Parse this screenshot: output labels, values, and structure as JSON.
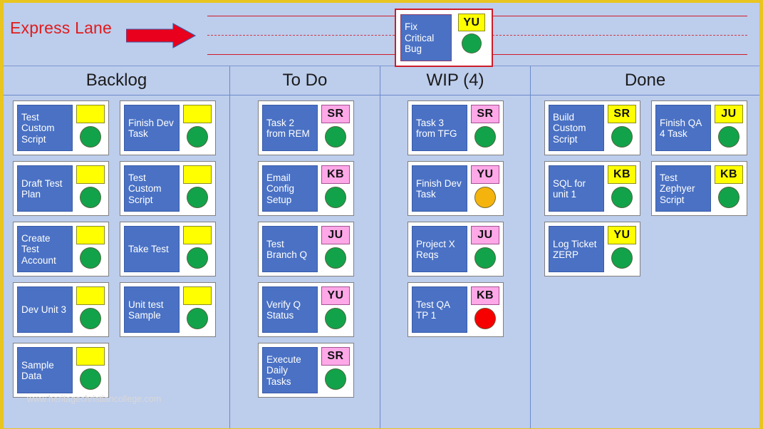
{
  "board": {
    "background_color": "#bdcdec",
    "frame_color": "#e8c520",
    "watermark": "www.heritagechristiancollege.com"
  },
  "express_lane": {
    "label": "Express Lane",
    "label_color": "#e01b1b",
    "arrow_icon": "right-arrow-icon",
    "arrow_color": "#e8001c",
    "line_color": "#cc1d29",
    "card": {
      "title": "Fix Critical Bug",
      "badge": "YU",
      "badge_color": "yellow",
      "status": "green"
    }
  },
  "columns": [
    {
      "id": "backlog",
      "title": "Backlog",
      "lanes": [
        {
          "cards": [
            {
              "title": "Test Custom Script",
              "badge": "",
              "badge_color": "yellow",
              "status": "green"
            },
            {
              "title": "Draft Test Plan",
              "badge": "",
              "badge_color": "yellow",
              "status": "green"
            },
            {
              "title": "Create Test Account",
              "badge": "",
              "badge_color": "yellow",
              "status": "green"
            },
            {
              "title": "Dev Unit 3",
              "badge": "",
              "badge_color": "yellow",
              "status": "green"
            },
            {
              "title": "Sample Data",
              "badge": "",
              "badge_color": "yellow",
              "status": "green"
            }
          ]
        },
        {
          "cards": [
            {
              "title": "Finish Dev Task",
              "badge": "",
              "badge_color": "yellow",
              "status": "green"
            },
            {
              "title": "Test Custom Script",
              "badge": "",
              "badge_color": "yellow",
              "status": "green"
            },
            {
              "title": "Take Test",
              "badge": "",
              "badge_color": "yellow",
              "status": "green"
            },
            {
              "title": "Unit test Sample",
              "badge": "",
              "badge_color": "yellow",
              "status": "green"
            }
          ]
        }
      ]
    },
    {
      "id": "todo",
      "title": "To Do",
      "lanes": [
        {
          "cards": [
            {
              "title": "Task 2 from REM",
              "badge": "SR",
              "badge_color": "pink",
              "status": "green"
            },
            {
              "title": "Email Config Setup",
              "badge": "KB",
              "badge_color": "pink",
              "status": "green"
            },
            {
              "title": "Test Branch Q",
              "badge": "JU",
              "badge_color": "pink",
              "status": "green"
            },
            {
              "title": "Verify Q Status",
              "badge": "YU",
              "badge_color": "pink",
              "status": "green"
            },
            {
              "title": "Execute Daily Tasks",
              "badge": "SR",
              "badge_color": "pink",
              "status": "green"
            }
          ]
        }
      ]
    },
    {
      "id": "wip",
      "title": "WIP (4)",
      "lanes": [
        {
          "cards": [
            {
              "title": "Task 3 from TFG",
              "badge": "SR",
              "badge_color": "pink",
              "status": "green"
            },
            {
              "title": "Finish Dev Task",
              "badge": "YU",
              "badge_color": "pink",
              "status": "amber"
            },
            {
              "title": "Project X Reqs",
              "badge": "JU",
              "badge_color": "pink",
              "status": "green"
            },
            {
              "title": "Test QA TP 1",
              "badge": "KB",
              "badge_color": "pink",
              "status": "red"
            }
          ]
        }
      ]
    },
    {
      "id": "done",
      "title": "Done",
      "lanes": [
        {
          "cards": [
            {
              "title": "Build Custom Script",
              "badge": "SR",
              "badge_color": "yellow",
              "status": "green"
            },
            {
              "title": "SQL for unit 1",
              "badge": "KB",
              "badge_color": "yellow",
              "status": "green"
            },
            {
              "title": "Log Ticket ZERP",
              "badge": "YU",
              "badge_color": "yellow",
              "status": "green"
            }
          ]
        },
        {
          "cards": [
            {
              "title": "Finish QA 4 Task",
              "badge": "JU",
              "badge_color": "yellow",
              "status": "green"
            },
            {
              "title": "Test Zephyer Script",
              "badge": "KB",
              "badge_color": "yellow",
              "status": "green"
            }
          ]
        }
      ]
    }
  ]
}
